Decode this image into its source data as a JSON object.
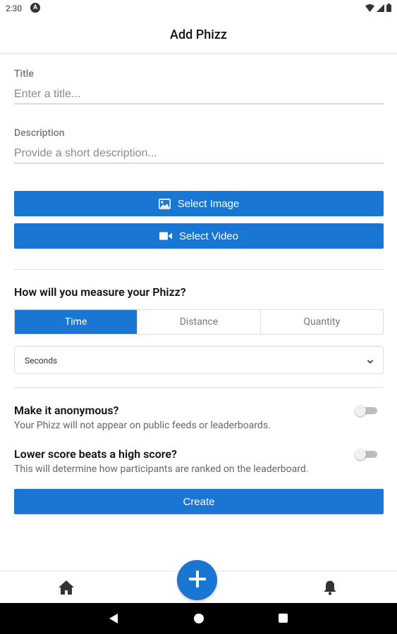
{
  "status_bar": {
    "time": "2:30",
    "notification_icon": "A",
    "icons": [
      "wifi-icon",
      "signal-icon",
      "battery-icon"
    ]
  },
  "header": {
    "title": "Add Phizz"
  },
  "form": {
    "title_label": "Title",
    "title_placeholder": "Enter a title...",
    "description_label": "Description",
    "description_placeholder": "Provide a short description...",
    "select_image_label": "Select Image",
    "select_video_label": "Select Video",
    "measure_heading": "How will you measure your Phizz?",
    "measure_tabs": [
      {
        "label": "Time",
        "active": true
      },
      {
        "label": "Distance",
        "active": false
      },
      {
        "label": "Quantity",
        "active": false
      }
    ],
    "unit_select_value": "Seconds",
    "anonymous_title": "Make it anonymous?",
    "anonymous_desc": "Your Phizz will not appear on public feeds or leaderboards.",
    "anonymous_enabled": false,
    "lower_score_title": "Lower score beats a high score?",
    "lower_score_desc": "This will determine how participants are ranked on the leaderboard.",
    "lower_score_enabled": false,
    "create_label": "Create"
  },
  "bottom_nav": {
    "home_icon": "home-icon",
    "fab_icon": "plus-icon",
    "notifications_icon": "bell-icon"
  },
  "colors": {
    "primary": "#1976d2",
    "system_nav": "#000000"
  }
}
